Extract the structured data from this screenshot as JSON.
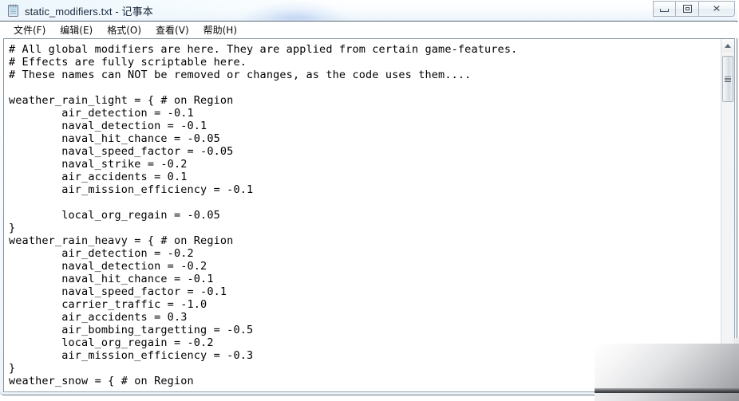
{
  "window": {
    "title": "static_modifiers.txt - 记事本",
    "icon": "notepad-icon",
    "controls": {
      "minimize_label": "",
      "maximize_label": "",
      "close_label": "✕"
    }
  },
  "menubar": {
    "items": [
      {
        "label": "文件(F)",
        "name": "menu-file"
      },
      {
        "label": "编辑(E)",
        "name": "menu-edit"
      },
      {
        "label": "格式(O)",
        "name": "menu-format"
      },
      {
        "label": "查看(V)",
        "name": "menu-view"
      },
      {
        "label": "帮助(H)",
        "name": "menu-help"
      }
    ]
  },
  "editor": {
    "lines": [
      "# All global modifiers are here. They are applied from certain game-features.",
      "# Effects are fully scriptable here.",
      "# These names can NOT be removed or changes, as the code uses them....",
      "",
      "weather_rain_light = { # on Region",
      "        air_detection = -0.1",
      "        naval_detection = -0.1",
      "        naval_hit_chance = -0.05",
      "        naval_speed_factor = -0.05",
      "        naval_strike = -0.2",
      "        air_accidents = 0.1",
      "        air_mission_efficiency = -0.1",
      "",
      "        local_org_regain = -0.05",
      "}",
      "weather_rain_heavy = { # on Region",
      "        air_detection = -0.2",
      "        naval_detection = -0.2",
      "        naval_hit_chance = -0.1",
      "        naval_speed_factor = -0.1",
      "        carrier_traffic = -1.0",
      "        air_accidents = 0.3",
      "        air_bombing_targetting = -0.5",
      "        local_org_regain = -0.2",
      "        air_mission_efficiency = -0.3",
      "}",
      "weather_snow = { # on Region"
    ]
  },
  "scrollbar": {
    "up_arrow": "scroll-up-arrow",
    "thumb": "scroll-thumb"
  },
  "colors": {
    "text": "#000000",
    "editor_background": "#ffffff",
    "titlebar_text": "#13243b",
    "frame_border": "#6f7b86"
  }
}
